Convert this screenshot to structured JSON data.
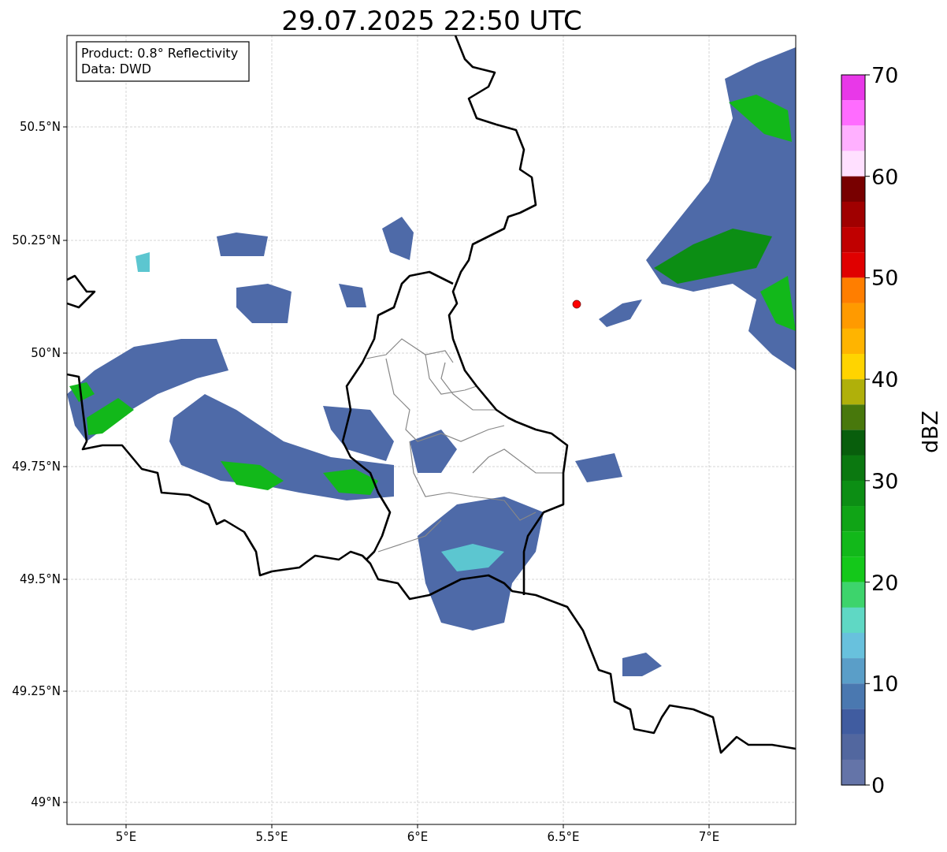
{
  "title": "29.07.2025 22:50 UTC",
  "annotation": [
    "Product: 0.8° Reflectivity",
    "Data: DWD"
  ],
  "xticks": [
    "5°E",
    "5.5°E",
    "6°E",
    "6.5°E",
    "7°E"
  ],
  "yticks": [
    "50.5°N",
    "50.25°N",
    "50°N",
    "49.75°N",
    "49.5°N",
    "49.25°N",
    "49°N"
  ],
  "colorbar": {
    "label": "dBZ",
    "ticks": [
      "70",
      "60",
      "50",
      "40",
      "30",
      "20",
      "10",
      "0"
    ],
    "segments": [
      {
        "color": "#e838e8"
      },
      {
        "color": "#ff6cff"
      },
      {
        "color": "#ffb0ff"
      },
      {
        "color": "#ffe0ff"
      },
      {
        "color": "#780000"
      },
      {
        "color": "#a00000"
      },
      {
        "color": "#c00000"
      },
      {
        "color": "#e00000"
      },
      {
        "color": "#ff7e00"
      },
      {
        "color": "#ff9a00"
      },
      {
        "color": "#ffb400"
      },
      {
        "color": "#ffd400"
      },
      {
        "color": "#b0b00a"
      },
      {
        "color": "#48780c"
      },
      {
        "color": "#085e0c"
      },
      {
        "color": "#0b7810"
      },
      {
        "color": "#0c8e14"
      },
      {
        "color": "#10a416"
      },
      {
        "color": "#12b81a"
      },
      {
        "color": "#14c81a"
      },
      {
        "color": "#3dd46c"
      },
      {
        "color": "#5fd8c4"
      },
      {
        "color": "#68c1dd"
      },
      {
        "color": "#5a9ec8"
      },
      {
        "color": "#4a78b0"
      },
      {
        "color": "#405ca0"
      },
      {
        "color": "#52679f"
      },
      {
        "color": "#6474a8"
      }
    ]
  }
}
